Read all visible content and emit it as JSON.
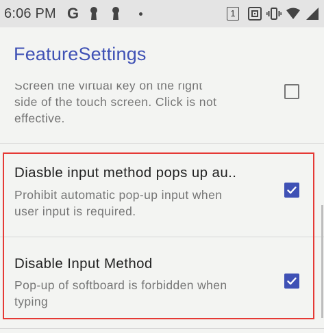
{
  "status_bar": {
    "time": "6:06 PM",
    "left_icons": [
      "google-g-icon",
      "keyhole-icon",
      "keyhole-icon",
      "notification-dot-icon"
    ],
    "sim_slot": "1",
    "right_icons": [
      "nfc-icon",
      "vibrate-icon",
      "wifi-icon",
      "signal-icon"
    ]
  },
  "app_bar": {
    "title": "FeatureSettings"
  },
  "preferences": [
    {
      "title": "",
      "summary_line1": "Screen the virtual key on the right",
      "summary_line2": "side of the touch screen. Click is not",
      "summary_line3": "effective.",
      "checked": false
    },
    {
      "title": "Diasble input method pops up au..",
      "summary_line1": "Prohibit automatic pop-up input when",
      "summary_line2": "user input is required.",
      "checked": true
    },
    {
      "title": "Disable Input Method",
      "summary_line1": "Pop-up of softboard is forbidden when",
      "summary_line2": "typing",
      "checked": true
    }
  ],
  "colors": {
    "accent": "#3f51b5",
    "highlight": "#e53935",
    "status_bar_bg": "#e4e4e4",
    "background": "#f3f4f2"
  }
}
